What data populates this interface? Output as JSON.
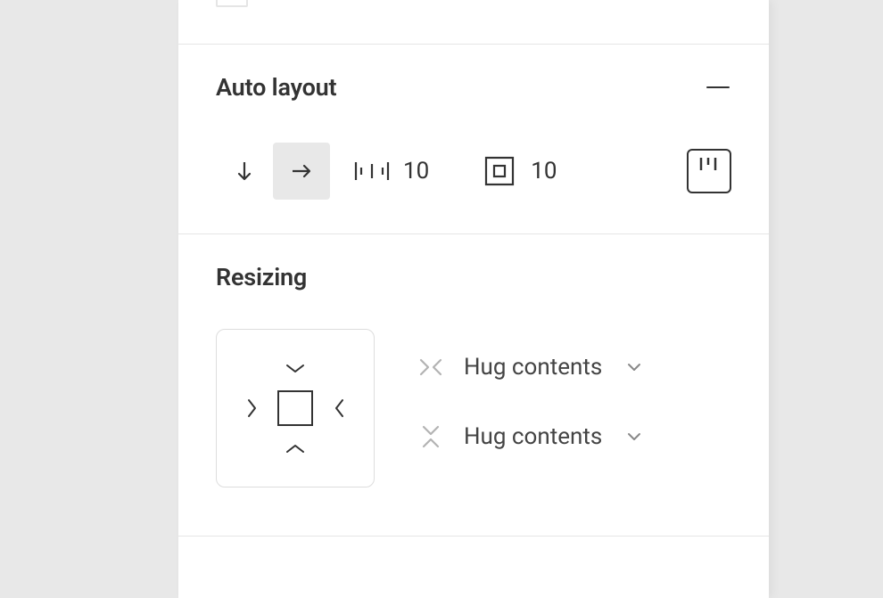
{
  "autoLayout": {
    "title": "Auto layout",
    "direction": "horizontal",
    "spacing": "10",
    "padding": "10"
  },
  "resizing": {
    "title": "Resizing",
    "width": {
      "label": "Hug contents",
      "mode": "hug"
    },
    "height": {
      "label": "Hug contents",
      "mode": "hug"
    }
  }
}
